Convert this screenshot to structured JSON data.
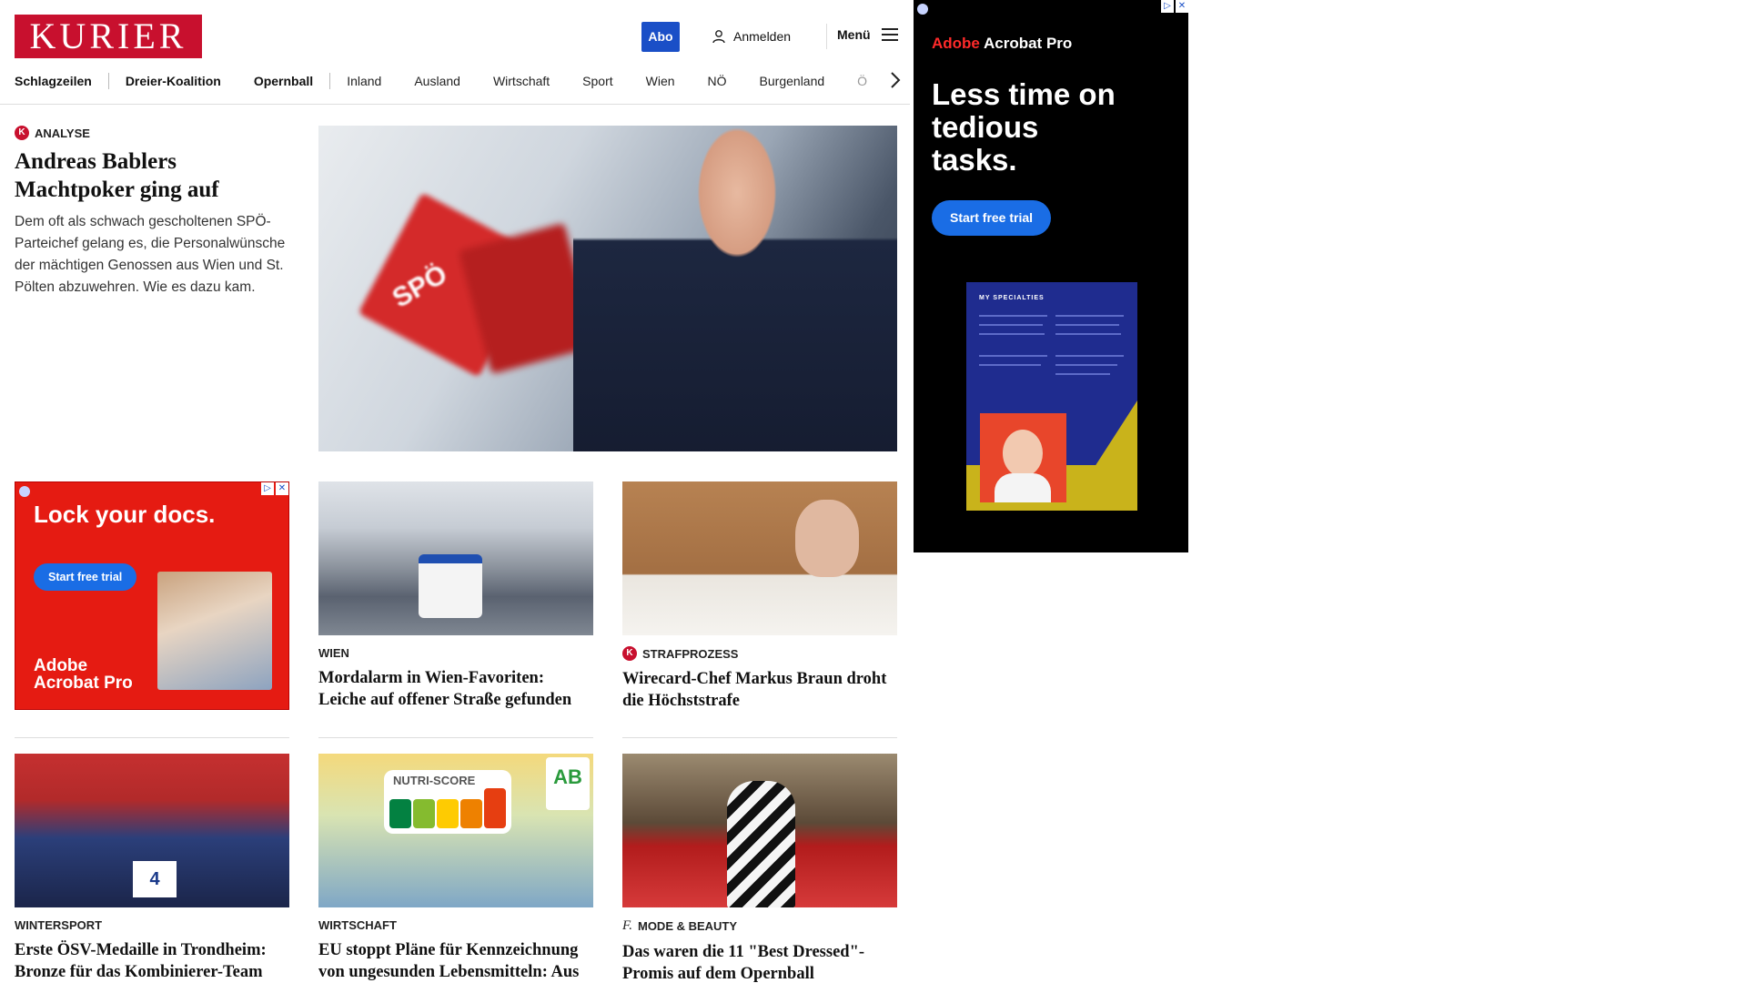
{
  "header": {
    "logo": "KURIER",
    "abo_label": "Abo",
    "login_label": "Anmelden",
    "menu_label": "Menü"
  },
  "nav": {
    "items": [
      "Schlagzeilen",
      "Dreier-Koalition",
      "Opernball",
      "Inland",
      "Ausland",
      "Wirtschaft",
      "Sport",
      "Wien",
      "NÖ",
      "Burgenland",
      "Ö"
    ]
  },
  "lead": {
    "kicker": "ANALYSE",
    "badge": "K",
    "title": "Andreas Bablers Machtpoker ging auf",
    "description": "Dem oft als schwach gescholtenen SPÖ-Parteichef gelang es, die Personalwünsche der mächtigen Genossen aus Wien und St. Pölten abzuwehren. Wie es dazu kam.",
    "photo_text": "SPÖ"
  },
  "ad_left": {
    "headline": "Lock your docs.",
    "cta": "Start free trial",
    "brand_line1": "Adobe",
    "brand_line2": "Acrobat Pro"
  },
  "cards": [
    {
      "kicker": "WIEN",
      "title": "Mordalarm in Wien-Favoriten: Leiche auf offener Straße gefunden"
    },
    {
      "kicker": "STRAFPROZESS",
      "badge": "K",
      "title": "Wirecard-Chef Markus Braun droht die Höchststrafe"
    },
    {
      "kicker": "WINTERSPORT",
      "title": "Erste ÖSV-Medaille in Trondheim: Bronze für das Kombinierer-Team"
    },
    {
      "kicker": "WIRTSCHAFT",
      "title": "EU stoppt Pläne für Kennzeichnung von ungesunden Lebensmitteln: Aus für Nutri-Score"
    },
    {
      "kicker": "MODE & BEAUTY",
      "badge": "f.",
      "title": "Das waren die 11 \"Best Dressed\"-Promis auf dem Opernball"
    }
  ],
  "photo_labels": {
    "nutri": "NUTRI-SCORE",
    "nutri_grades": [
      "A",
      "B",
      "C",
      "D",
      "E"
    ],
    "bio": "AB",
    "ski_bib": "4"
  },
  "ad_right": {
    "brand": "Adobe",
    "product": "Acrobat Pro",
    "headline": "Less time on tedious tasks.",
    "cta": "Start free trial",
    "doc_title": "MY SPECIALTIES"
  },
  "colors": {
    "brand_red": "#c8102e",
    "abo_blue": "#1a4fc7",
    "adobe_cta": "#1a6de5",
    "ad_red": "#e51b12"
  }
}
